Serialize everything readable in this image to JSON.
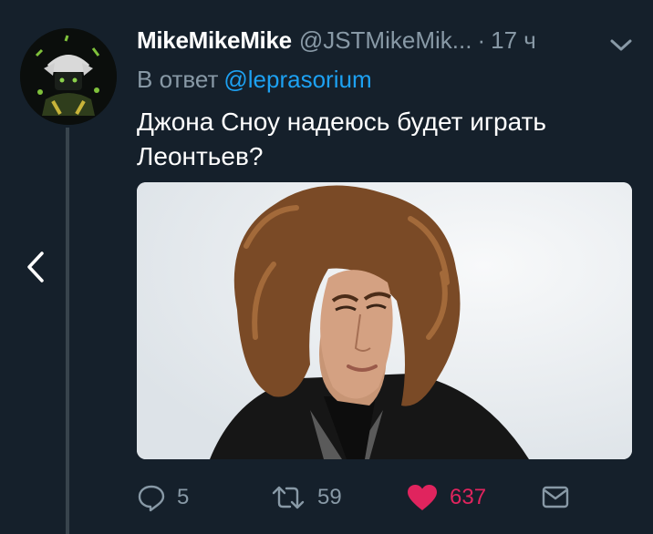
{
  "tweet": {
    "display_name": "MikeMikeMike",
    "handle": "@JSTMikeMik...",
    "separator": "·",
    "time": "17 ч",
    "reply_prefix": "В ответ",
    "reply_mention": "@leprasorium",
    "text": "Джона Сноу надеюсь будет играть Леонтьев?"
  },
  "actions": {
    "reply_count": "5",
    "retweet_count": "59",
    "like_count": "637"
  },
  "colors": {
    "background": "#15202b",
    "secondary_text": "#8899a6",
    "link": "#1da1f2",
    "like": "#e0245e"
  },
  "icons": [
    "back-chevron-icon",
    "menu-chevron-icon",
    "reply-icon",
    "retweet-icon",
    "heart-icon",
    "direct-message-icon"
  ]
}
